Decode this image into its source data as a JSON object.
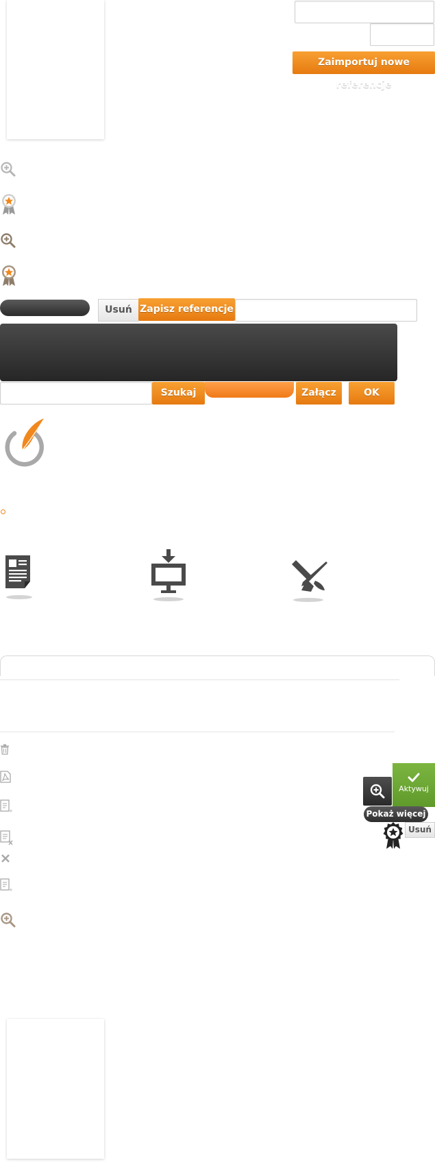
{
  "top": {
    "import_button": "Zaimportuj nowe referencje"
  },
  "reference_form": {
    "delete_button": "Usuń",
    "save_button": "Zapisz referencje"
  },
  "search_row": {
    "search_button": "Szukaj",
    "attach_button": "Załącz",
    "ok_button": "OK"
  },
  "item_actions": {
    "activate_label": "Aktywuj",
    "show_more_button": "Pokaż więcej",
    "delete_button": "Usuń"
  },
  "colors": {
    "accent": "#f0881e",
    "dark": "#333333",
    "green": "#6ea536"
  }
}
